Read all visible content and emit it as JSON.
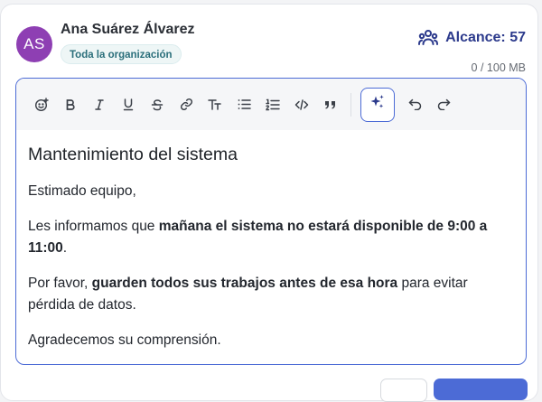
{
  "author": {
    "initials": "AS",
    "name": "Ana Suárez Álvarez",
    "audience": "Toda la organización",
    "avatar_color": "#8e3fb3"
  },
  "reach": {
    "label": "Alcance: 57",
    "icon": "users-icon"
  },
  "storage": "0 / 100 MB",
  "toolbar": {
    "items": [
      "emoji-icon",
      "bold-icon",
      "italic-icon",
      "underline-icon",
      "strikethrough-icon",
      "link-icon",
      "text-size-icon",
      "bullet-list-icon",
      "numbered-list-icon",
      "code-icon",
      "quote-icon",
      "ai-sparkle-icon",
      "undo-icon",
      "redo-icon"
    ]
  },
  "message": {
    "title": "Mantenimiento del sistema",
    "greeting": "Estimado equipo,",
    "p1_before": "Les informamos que ",
    "p1_bold": "mañana el sistema no estará disponible de 9:00 a 11:00",
    "p1_after": ".",
    "p2_before": "Por favor, ",
    "p2_bold": "guarden todos sus trabajos antes de esa hora",
    "p2_after": " para evitar pérdida de datos.",
    "closing": "Agradecemos su comprensión."
  },
  "colors": {
    "accent": "#4c6bd6",
    "reach_text": "#2c3a8c",
    "badge_text": "#2b6f7b"
  }
}
